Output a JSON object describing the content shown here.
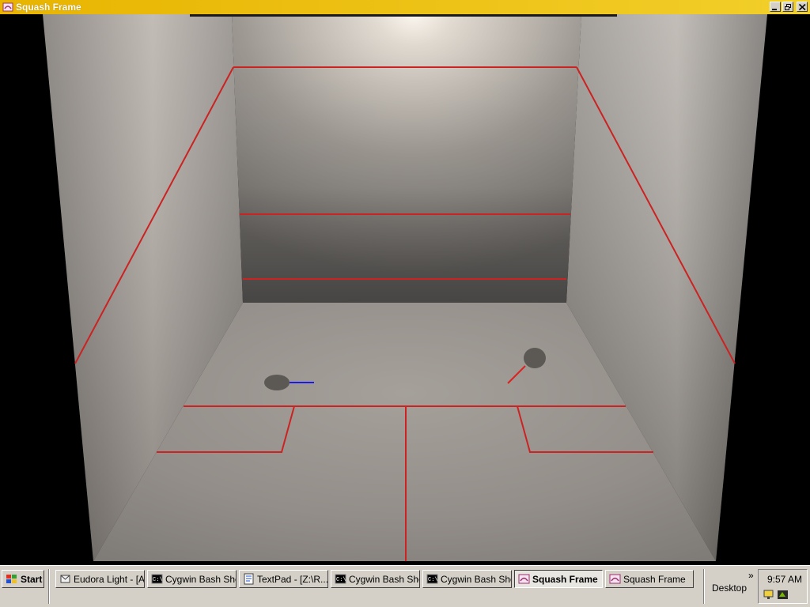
{
  "window": {
    "title": "Squash Frame"
  },
  "colors": {
    "title_bar": "#e8b400",
    "court_line": "#cc2222",
    "racket_red": "#dd2222",
    "racket_blue": "#1a1aee",
    "taskbar": "#d4d0c8"
  },
  "court": {
    "icon": "squash-court-3d-view",
    "players": [
      {
        "name": "player-blue",
        "racket_color": "#1a1aee"
      },
      {
        "name": "player-red",
        "racket_color": "#dd2222"
      }
    ]
  },
  "taskbar": {
    "start_label": "Start",
    "tasks": [
      {
        "label": "Eudora Light - [A...",
        "icon": "eudora-icon",
        "active": false
      },
      {
        "label": "Cygwin Bash Shell",
        "icon": "console-icon",
        "active": false
      },
      {
        "label": "TextPad - [Z:\\R...",
        "icon": "textpad-icon",
        "active": false
      },
      {
        "label": "Cygwin Bash Shell",
        "icon": "console-icon",
        "active": false
      },
      {
        "label": "Cygwin Bash Shell",
        "icon": "console-icon",
        "active": false
      },
      {
        "label": "Squash Frame",
        "icon": "java-icon",
        "active": true
      },
      {
        "label": "Squash Frame",
        "icon": "java-icon",
        "active": false
      }
    ],
    "desktop_label": "Desktop",
    "chevron": "»",
    "clock": "9:57 AM"
  }
}
